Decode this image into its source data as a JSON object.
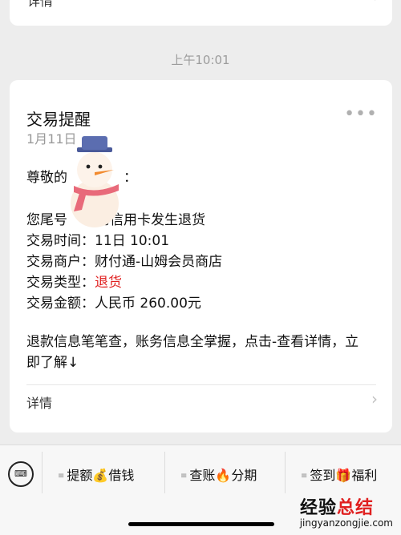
{
  "prev_card": {
    "label": "详情"
  },
  "timestamp": "上午10:01",
  "message": {
    "title": "交易提醒",
    "date": "1月11日",
    "greeting": "尊敬的",
    "greeting_tail": "：",
    "card_line_prefix": "您尾号",
    "card_line_suffix": "的信用卡发生退货",
    "fields": [
      {
        "label": "交易时间：",
        "value": "11日 10:01"
      },
      {
        "label": "交易商户：",
        "value": "财付通-山姆会员商店"
      },
      {
        "label": "交易类型：",
        "value": "退货"
      },
      {
        "label": "交易金额：",
        "value": "人民币 260.00元"
      }
    ],
    "promo": "退款信息笔笔查，账务信息全掌握，点击-查看详情，立即了解↓",
    "detail_label": "详情",
    "highlight_color": "#e02020"
  },
  "bottom_menu": {
    "keyboard_icon": "keyboard-icon",
    "items": [
      {
        "label_a": "提额",
        "emoji": "💰",
        "label_b": "借钱"
      },
      {
        "label_a": "查账",
        "emoji": "🔥",
        "label_b": "分期"
      },
      {
        "label_a": "签到",
        "emoji": "🎁",
        "label_b": "福利"
      }
    ]
  },
  "watermark": {
    "part1": "经验",
    "part2": "总结",
    "url": "jingyanzongjie.com"
  }
}
